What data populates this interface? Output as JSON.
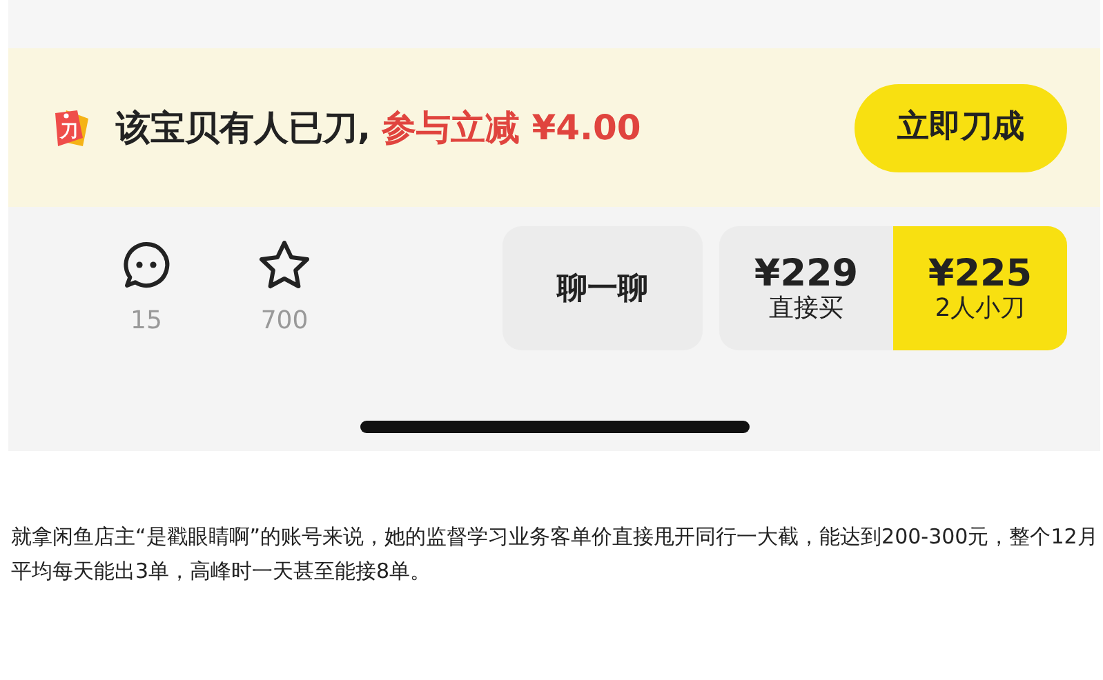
{
  "banner": {
    "badge_text": "刀",
    "message": "该宝贝有人已刀,",
    "highlight": "参与立减 ¥4.00",
    "button": "立即刀成"
  },
  "actions": [
    {
      "kind": "comment",
      "count": "15"
    },
    {
      "kind": "star",
      "count": "700"
    }
  ],
  "chat_button": "聊一聊",
  "buy_options": [
    {
      "price": "¥229",
      "label": "直接买",
      "selected": false
    },
    {
      "price": "¥225",
      "label": "2人小刀",
      "selected": true
    }
  ],
  "caption": "就拿闲鱼店主“是戳眼睛啊”的账号来说，她的监督学习业务客单价直接甩开同行一大截，能达到200-300元，整个12月平均每天能出3单，高峰时一天甚至能接8单。"
}
